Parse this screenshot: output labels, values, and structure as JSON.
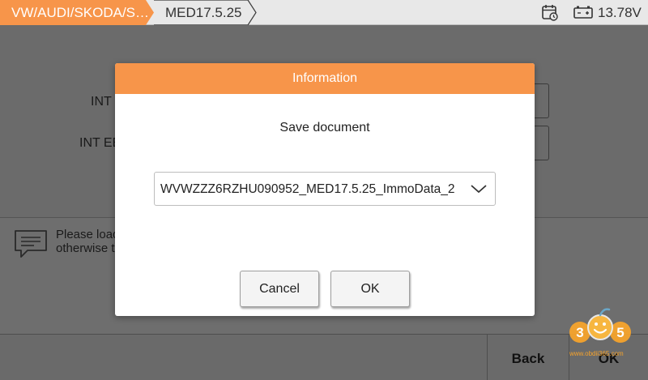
{
  "header": {
    "breadcrumbs": [
      "VW/AUDI/SKODA/S…",
      "MED17.5.25"
    ],
    "voltage": "13.78V",
    "accent_color": "#f7954a",
    "icons": [
      "calendar-clock-icon",
      "battery-icon"
    ]
  },
  "background": {
    "field_labels": [
      "INT",
      "INT EE"
    ],
    "message_line1": "Please load",
    "message_line2": "otherwise t",
    "message_icon": "message-bubble-icon"
  },
  "bottom_bar": {
    "back_label": "Back",
    "ok_label": "OK"
  },
  "dialog": {
    "title": "Information",
    "message": "Save document",
    "selected_file": "WVWZZZ6RZHU090952_MED17.5.25_ImmoData_2",
    "cancel_label": "Cancel",
    "ok_label": "OK"
  },
  "watermark": {
    "logo_text": "365",
    "url": "www.obdii365.com"
  }
}
